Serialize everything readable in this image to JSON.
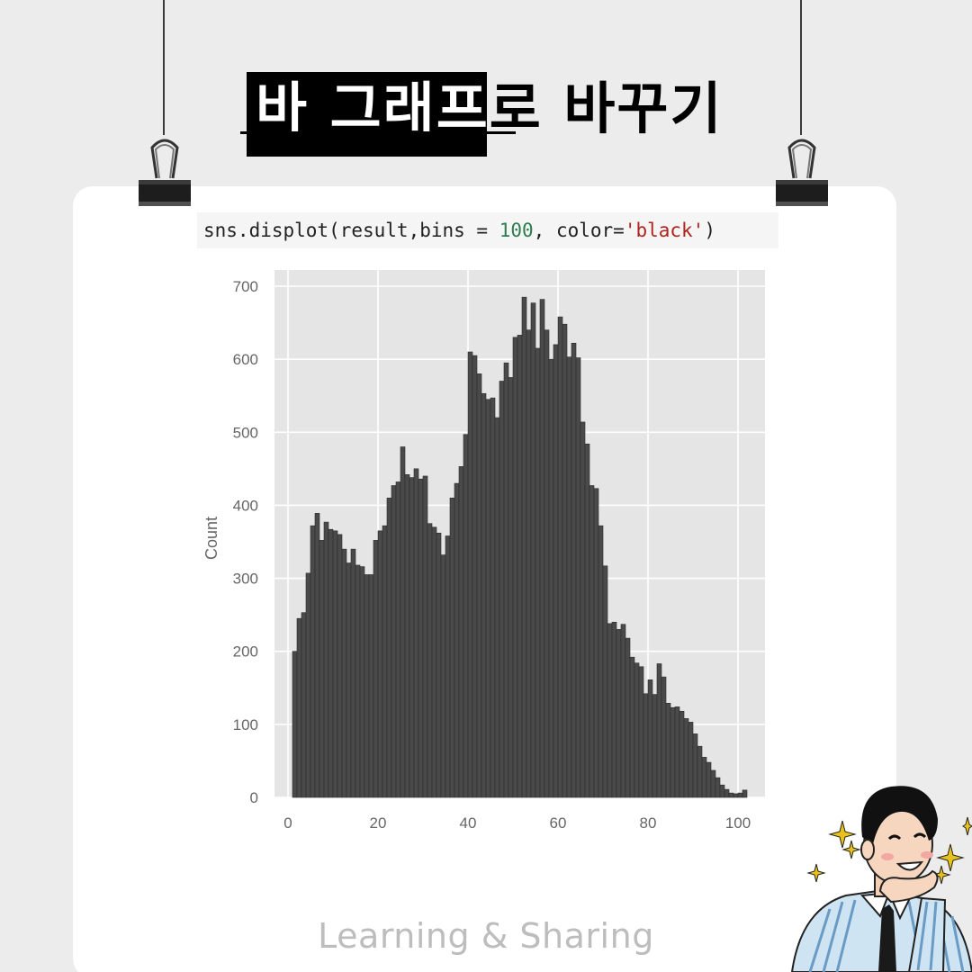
{
  "title": "바 그래프로 바꾸기",
  "code": {
    "prefix": "sns.displot(result,bins = ",
    "number": "100",
    "middle": ", color=",
    "string": "'black'",
    "suffix": ")"
  },
  "footer": "Learning & Sharing",
  "colors": {
    "background": "#ececec",
    "card": "#ffffff",
    "plot_area": "#e5e5e5",
    "bars": "#4a4a4a"
  },
  "icons": [
    "binder-clip-icon",
    "cartoon-man-icon",
    "sparkle-icon"
  ],
  "chart_data": {
    "type": "bar",
    "title": "",
    "xlabel": "",
    "ylabel": "Count",
    "xlim": [
      -3,
      106
    ],
    "ylim": [
      0,
      700
    ],
    "xticks": [
      0,
      20,
      40,
      60,
      80,
      100
    ],
    "yticks": [
      0,
      100,
      200,
      300,
      400,
      500,
      600,
      700
    ],
    "grid": true,
    "bin_start": 1,
    "bin_width": 1,
    "values": [
      200,
      245,
      253,
      307,
      372,
      389,
      352,
      377,
      367,
      365,
      360,
      340,
      321,
      340,
      318,
      316,
      305,
      305,
      352,
      365,
      372,
      410,
      427,
      432,
      480,
      442,
      438,
      450,
      436,
      440,
      375,
      370,
      362,
      332,
      358,
      410,
      430,
      453,
      497,
      610,
      605,
      580,
      553,
      545,
      547,
      520,
      570,
      595,
      575,
      630,
      633,
      685,
      640,
      677,
      615,
      682,
      640,
      600,
      620,
      658,
      648,
      603,
      622,
      602,
      514,
      484,
      427,
      423,
      372,
      317,
      238,
      240,
      230,
      237,
      218,
      192,
      184,
      179,
      142,
      161,
      141,
      183,
      165,
      129,
      123,
      124,
      118,
      108,
      103,
      87,
      70,
      55,
      48,
      37,
      27,
      17,
      11,
      6,
      5,
      6,
      10
    ]
  }
}
